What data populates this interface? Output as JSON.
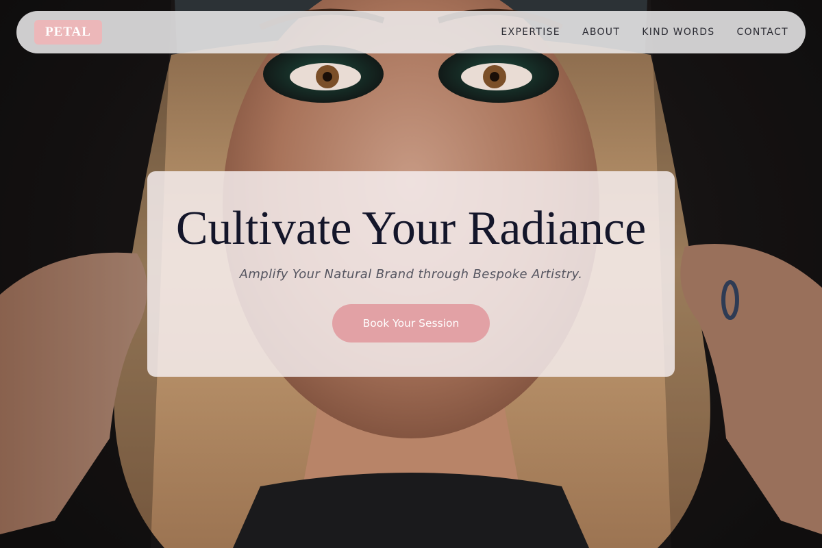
{
  "brand": {
    "logo_text": "PETAL"
  },
  "nav": {
    "links": [
      {
        "label": "EXPERTISE"
      },
      {
        "label": "ABOUT"
      },
      {
        "label": "KIND WORDS"
      },
      {
        "label": "CONTACT"
      }
    ]
  },
  "hero": {
    "title": "Cultivate Your Radiance",
    "subtitle": "Amplify Your Natural Brand through Bespoke Artistry.",
    "cta_label": "Book Your Session"
  },
  "colors": {
    "accent_pink": "#e2a1a5",
    "logo_pink": "#ecb7b9",
    "title_navy": "#14162a",
    "backdrop_dark": "#1b1818"
  }
}
